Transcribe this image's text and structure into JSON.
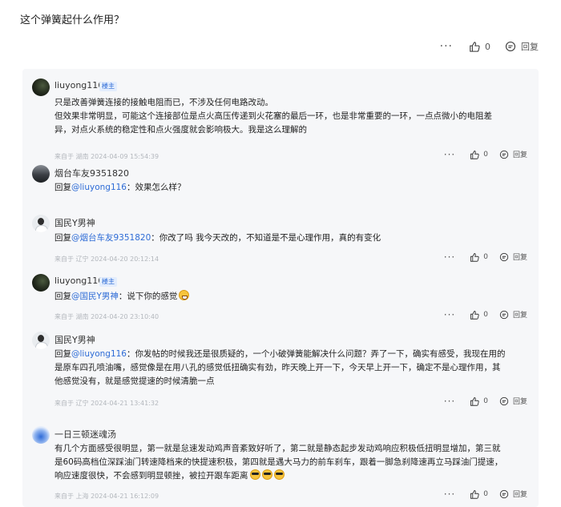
{
  "question": "这个弹簧起什么作用？",
  "top_actions": {
    "more": "···",
    "like_count": "0",
    "reply": "回复"
  },
  "comments": [
    {
      "author": "liuyong116",
      "badge": "楼主",
      "text_lines": [
        " 只是改善弹簧连接的接触电阻而已，不涉及任何电路改动。",
        "但效果非常明显，可能这个连接部位是点火高压传递到火花塞的最后一环，也是非常重要的一环，一点点微小的电阻差",
        "异，对点火系统的稳定性和点火强度就会影响极大。我是这么理解的"
      ],
      "meta": "来自于 湖南 2024-04-09 15:54:39",
      "likes": "0",
      "reply": "回复"
    },
    {
      "author": "烟台车友9351820",
      "reply_prefix": "回复",
      "mention": "@liuyong116",
      "text": "：效果怎么样？"
    },
    {
      "author": "国民Y男神",
      "reply_prefix": "回复",
      "mention": "@烟台车友9351820",
      "text": "：你改了吗 我今天改的，不知道是不是心理作用，真的有变化",
      "meta": "来自于 辽宁 2024-04-20 20:12:14",
      "likes": "0",
      "reply": "回复"
    },
    {
      "author": "liuyong116",
      "badge": "楼主",
      "reply_prefix": "回复",
      "mention": "@国民Y男神",
      "text": "：说下你的感觉",
      "meta": "来自于 湖南 2024-04-20 23:10:40",
      "likes": "0",
      "reply": "回复"
    },
    {
      "author": "国民Y男神",
      "reply_prefix": "回复",
      "mention": "@liuyong116",
      "text_lines": [
        "：你发帖的时候我还是很质疑的，一个小破弹簧能解决什么问题？弄了一下，确实有感受，我现在用的",
        "是原车四孔喷油嘴，感觉像是在用八孔的感觉低扭确实有劲，昨天晚上开一下，今天早上开一下，确定不是心理作用，其",
        "他感觉没有，就是感觉提速的时候清脆一点"
      ],
      "meta": "来自于 辽宁 2024-04-21 13:41:32",
      "likes": "0",
      "reply": "回复"
    },
    {
      "author": "一日三顿迷魂汤",
      "text_lines": [
        "有几个方面感受很明显，第一就是怠速发动鸡声音紊致好听了，第二就是静态起步发动鸡响应积极低扭明显增加，第三就",
        "是60码高档位深踩油门转速降档来的快提速积极，第四就是遇大马力的前车刹车，跟着一脚急刹降速再立马踩油门提速，",
        "响应速度很快，不会感到明显顿挫，被拉开跟车距离"
      ],
      "meta": "来自于 上海 2024-04-21 16:12:09",
      "likes": "0",
      "reply": "回复"
    }
  ]
}
